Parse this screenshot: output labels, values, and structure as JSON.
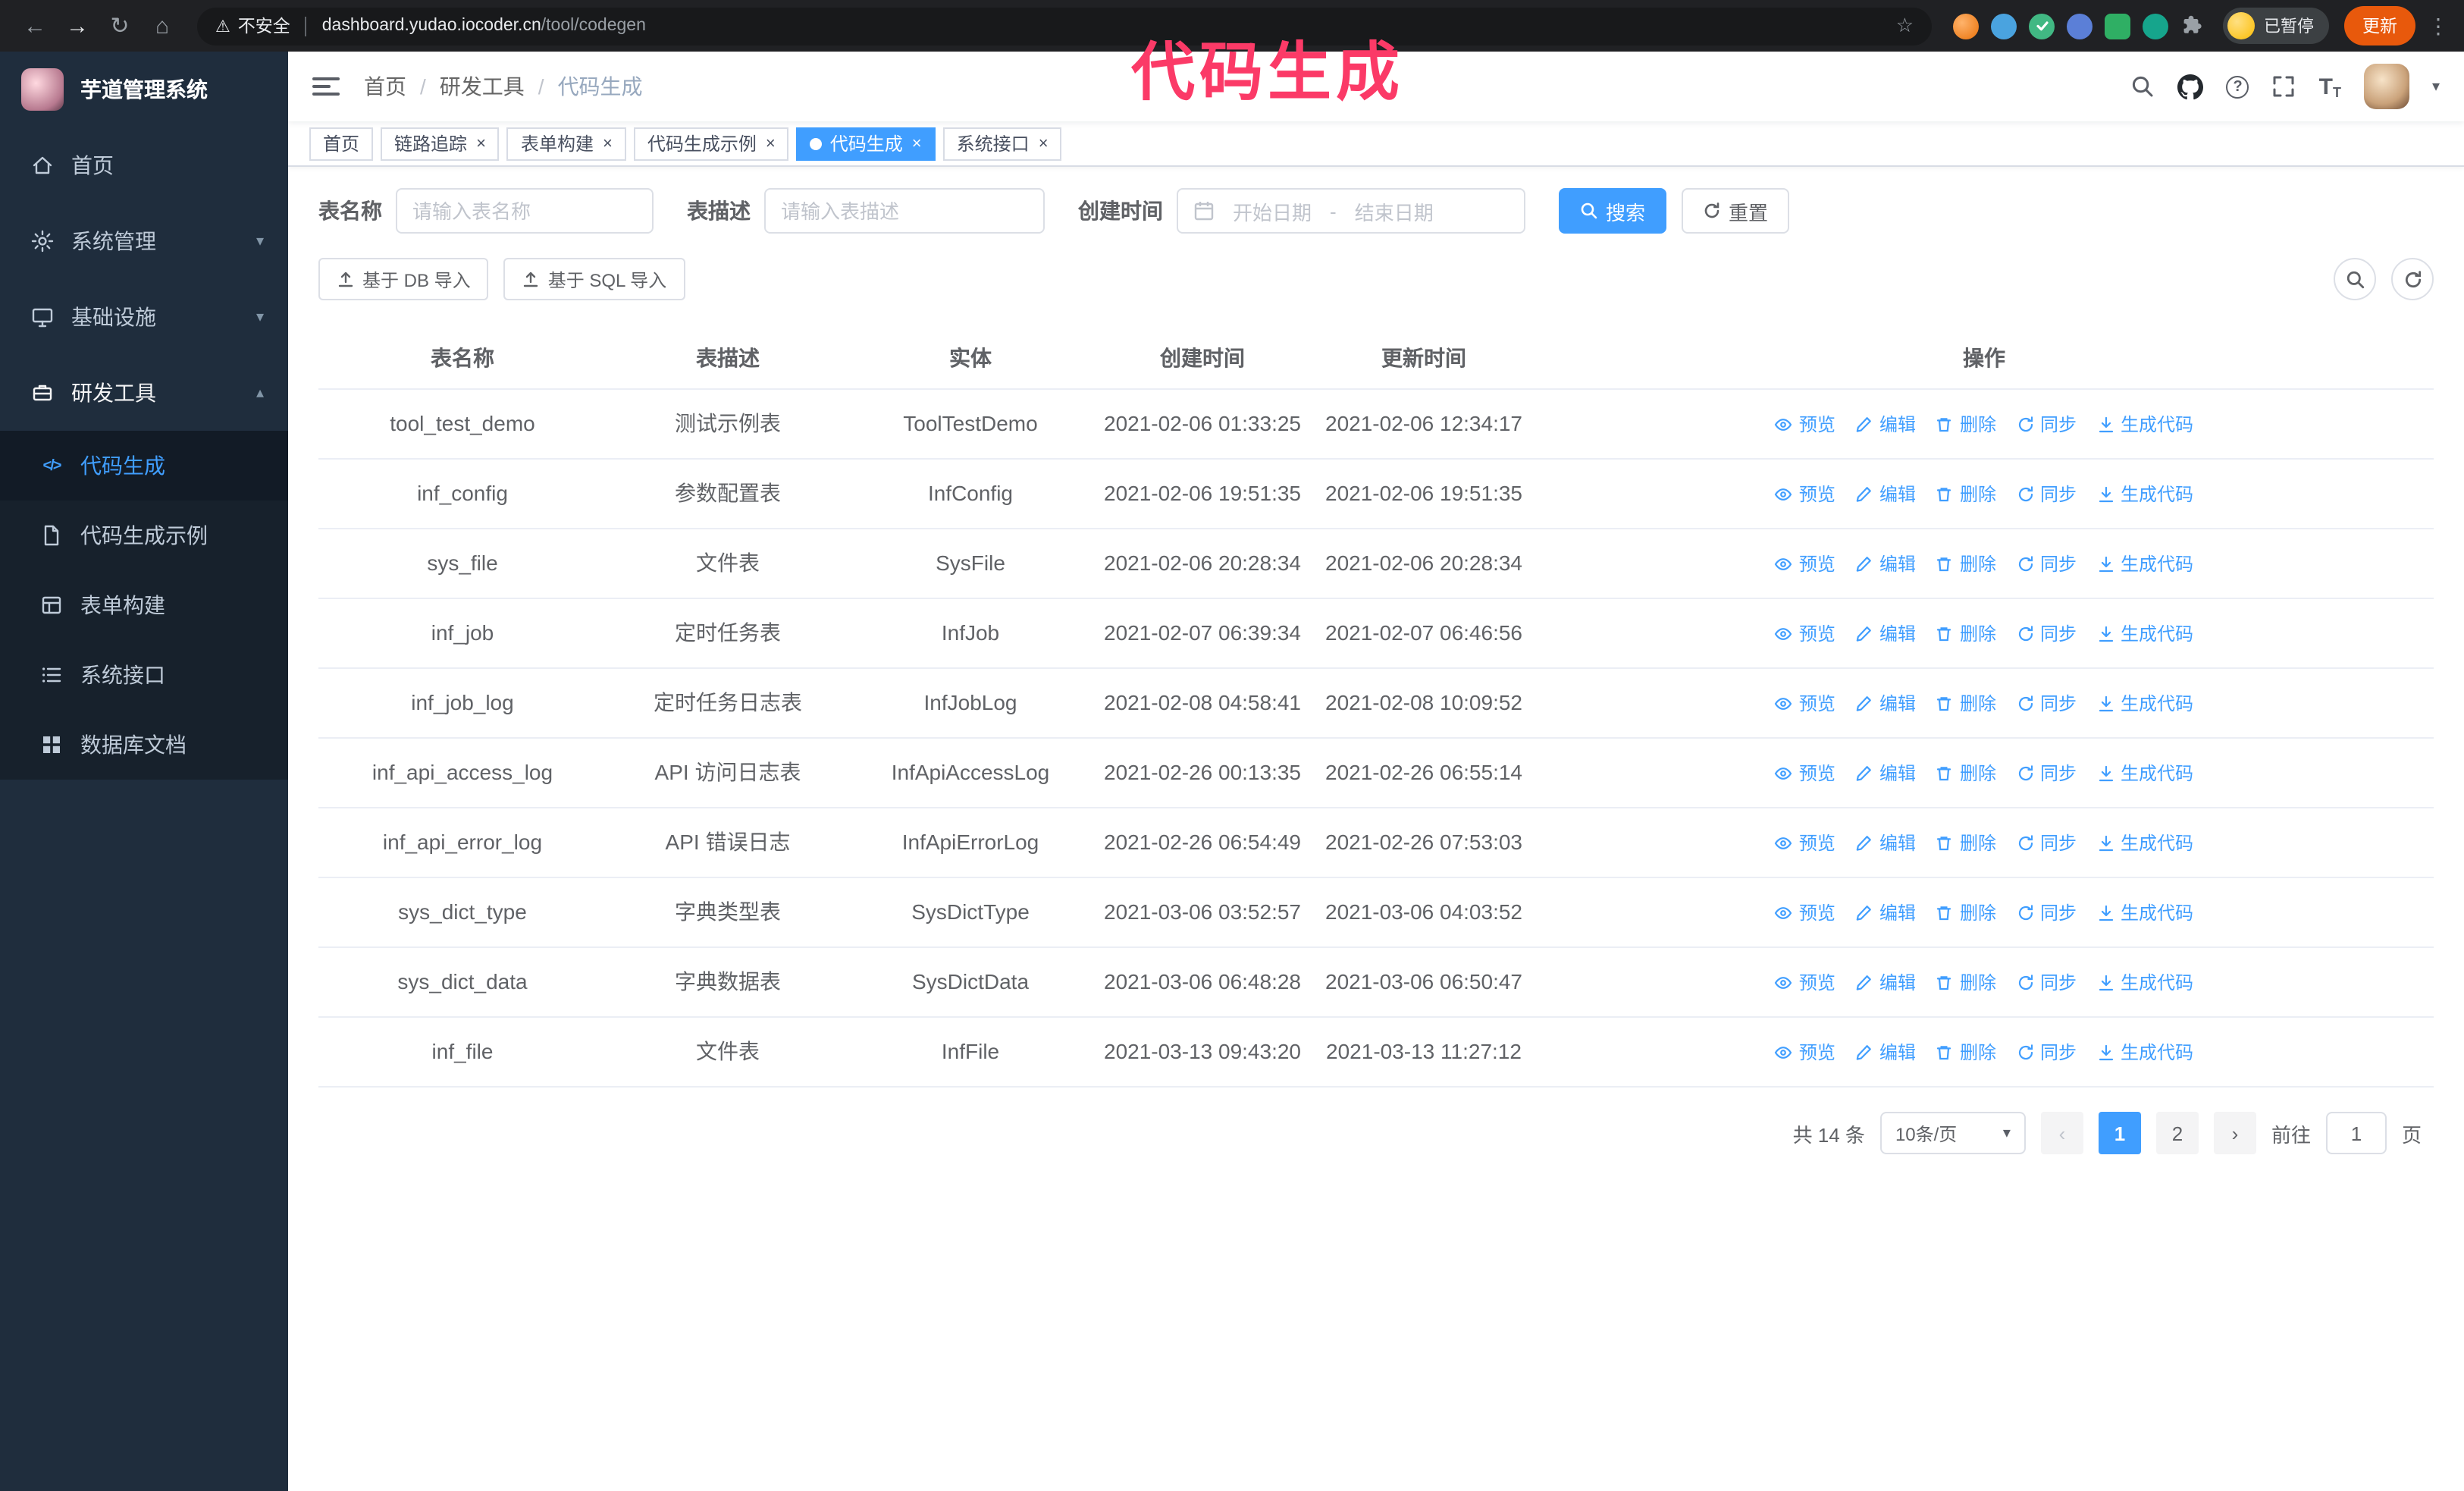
{
  "browser": {
    "back_icon": "←",
    "forward_icon": "→",
    "reload_icon": "↻",
    "home_icon": "⌂",
    "warning_icon": "⚠",
    "security_warning": "不安全",
    "url_domain": "dashboard.yudao.iocoder.cn",
    "url_path": "/tool/codegen",
    "star_icon": "☆",
    "paused_badge": "已暂停",
    "update_button": "更新",
    "kebab_icon": "⋮"
  },
  "annotation": {
    "text": "代码生成",
    "color": "#fb3a67"
  },
  "sidebar": {
    "logo_title": "芋道管理系统",
    "items": [
      {
        "label": "首页"
      },
      {
        "label": "系统管理",
        "chevron": "▾"
      },
      {
        "label": "基础设施",
        "chevron": "▾"
      },
      {
        "label": "研发工具",
        "chevron": "▴"
      }
    ],
    "sub_items": [
      {
        "label": "代码生成",
        "icon": "</>",
        "active": true
      },
      {
        "label": "代码生成示例"
      },
      {
        "label": "表单构建"
      },
      {
        "label": "系统接口"
      },
      {
        "label": "数据库文档"
      }
    ]
  },
  "header": {
    "breadcrumb": [
      "首页",
      "研发工具",
      "代码生成"
    ],
    "separator": "/",
    "question_glyph": "?",
    "fontsize_glyph": "T",
    "fontsize_glyph_small": "T",
    "caret_icon": "▾"
  },
  "tabs": {
    "close_icon": "×",
    "items": [
      {
        "label": "首页",
        "closable": false,
        "active": false
      },
      {
        "label": "链路追踪",
        "closable": true,
        "active": false
      },
      {
        "label": "表单构建",
        "closable": true,
        "active": false
      },
      {
        "label": "代码生成示例",
        "closable": true,
        "active": false
      },
      {
        "label": "代码生成",
        "closable": true,
        "active": true
      },
      {
        "label": "系统接口",
        "closable": true,
        "active": false
      }
    ]
  },
  "filters": {
    "table_name_label": "表名称",
    "table_name_placeholder": "请输入表名称",
    "table_desc_label": "表描述",
    "table_desc_placeholder": "请输入表描述",
    "create_time_label": "创建时间",
    "date_start_placeholder": "开始日期",
    "date_separator": "-",
    "date_end_placeholder": "结束日期",
    "search_button": "搜索",
    "reset_button": "重置"
  },
  "toolbar": {
    "import_db_button": "基于 DB 导入",
    "import_sql_button": "基于 SQL 导入"
  },
  "table": {
    "columns": [
      "表名称",
      "表描述",
      "实体",
      "创建时间",
      "更新时间",
      "操作"
    ],
    "actions": [
      "预览",
      "编辑",
      "删除",
      "同步",
      "生成代码"
    ],
    "rows": [
      {
        "name": "tool_test_demo",
        "desc": "测试示例表",
        "entity": "ToolTestDemo",
        "created": "2021-02-06 01:33:25",
        "updated": "2021-02-06 12:34:17"
      },
      {
        "name": "inf_config",
        "desc": "参数配置表",
        "entity": "InfConfig",
        "created": "2021-02-06 19:51:35",
        "updated": "2021-02-06 19:51:35"
      },
      {
        "name": "sys_file",
        "desc": "文件表",
        "entity": "SysFile",
        "created": "2021-02-06 20:28:34",
        "updated": "2021-02-06 20:28:34"
      },
      {
        "name": "inf_job",
        "desc": "定时任务表",
        "entity": "InfJob",
        "created": "2021-02-07 06:39:34",
        "updated": "2021-02-07 06:46:56"
      },
      {
        "name": "inf_job_log",
        "desc": "定时任务日志表",
        "entity": "InfJobLog",
        "created": "2021-02-08 04:58:41",
        "updated": "2021-02-08 10:09:52"
      },
      {
        "name": "inf_api_access_log",
        "desc": "API 访问日志表",
        "entity": "InfApiAccessLog",
        "created": "2021-02-26 00:13:35",
        "updated": "2021-02-26 06:55:14"
      },
      {
        "name": "inf_api_error_log",
        "desc": "API 错误日志",
        "entity": "InfApiErrorLog",
        "created": "2021-02-26 06:54:49",
        "updated": "2021-02-26 07:53:03"
      },
      {
        "name": "sys_dict_type",
        "desc": "字典类型表",
        "entity": "SysDictType",
        "created": "2021-03-06 03:52:57",
        "updated": "2021-03-06 04:03:52"
      },
      {
        "name": "sys_dict_data",
        "desc": "字典数据表",
        "entity": "SysDictData",
        "created": "2021-03-06 06:48:28",
        "updated": "2021-03-06 06:50:47"
      },
      {
        "name": "inf_file",
        "desc": "文件表",
        "entity": "InfFile",
        "created": "2021-03-13 09:43:20",
        "updated": "2021-03-13 11:27:12"
      }
    ]
  },
  "pagination": {
    "total": "共 14 条",
    "page_size": "10条/页",
    "caret_icon": "▾",
    "prev_icon": "‹",
    "next_icon": "›",
    "pages": [
      "1",
      "2"
    ],
    "active_page": "1",
    "goto_label": "前往",
    "goto_value": "1",
    "goto_suffix": "页"
  },
  "colors": {
    "accent": "#409eff",
    "annotation": "#fb3a67",
    "update_button": "#e8590c",
    "sidebar_bg": "#1f2d3d",
    "submenu_bg": "#17212c",
    "active_tab_bg": "#409eff"
  }
}
